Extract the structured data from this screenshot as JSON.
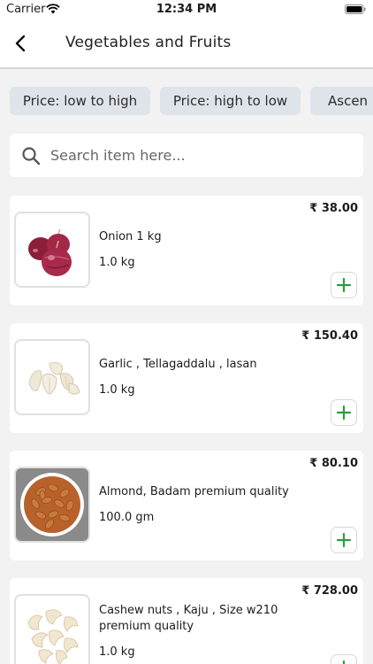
{
  "status_bar": {
    "carrier": "Carrier",
    "time": "12:34 PM"
  },
  "header": {
    "title": "Vegetables and Fruits",
    "back_icon": "chevron-left-icon"
  },
  "filters": [
    {
      "label": "Price: low to high"
    },
    {
      "label": "Price: high to low"
    },
    {
      "label": "Ascen"
    }
  ],
  "search": {
    "placeholder": "Search item here...",
    "value": "",
    "icon": "search-icon"
  },
  "products": [
    {
      "name": "Onion 1 kg",
      "quantity": "1.0 kg",
      "price": "₹ 38.00",
      "image": "onion"
    },
    {
      "name": "Garlic ,  Tellagaddalu , lasan",
      "quantity": "1.0 kg",
      "price": "₹ 150.40",
      "image": "garlic"
    },
    {
      "name": "Almond, Badam premium quality",
      "quantity": "100.0 gm",
      "price": "₹ 80.10",
      "image": "almond"
    },
    {
      "name": "Cashew nuts , Kaju , Size w210 premium quality",
      "quantity": "1.0 kg",
      "price": "₹ 728.00",
      "image": "cashew"
    }
  ],
  "colors": {
    "accent_green": "#2e9b45",
    "chip_background": "#dfe4ea",
    "page_background": "#f2f2f2"
  }
}
